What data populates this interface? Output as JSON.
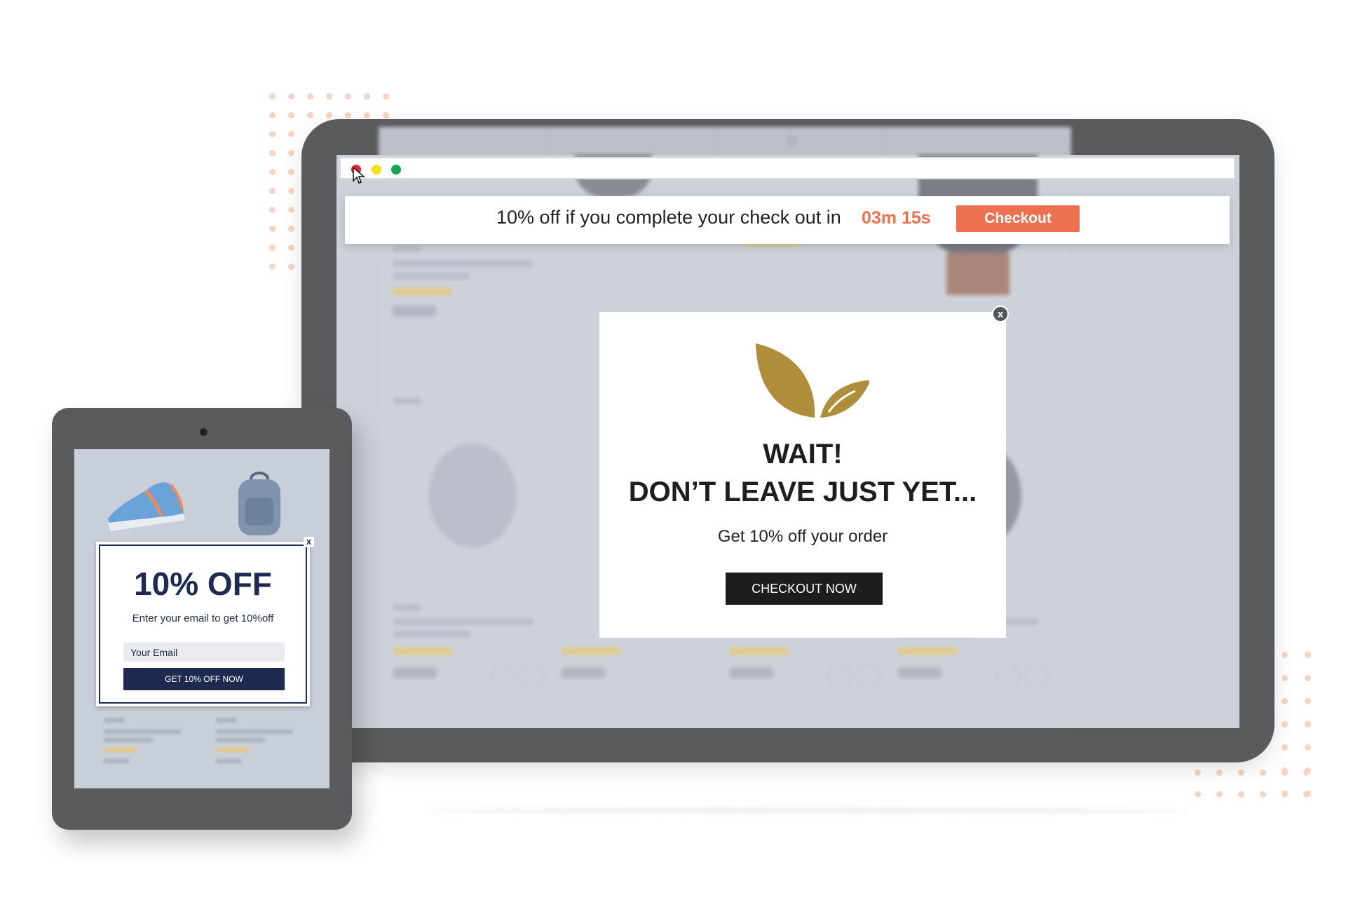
{
  "browser": {
    "window_buttons": [
      "close-dot",
      "minimize-dot",
      "maximize-dot"
    ]
  },
  "top_banner": {
    "message": "10% off if you complete your check out in",
    "timer": "03m 15s",
    "button_label": "Checkout",
    "accent_color": "#ee714f"
  },
  "exit_popup": {
    "close_label": "x",
    "logo_icon": "leaf-logo-icon",
    "headline_line1": "WAIT!",
    "headline_line2": "DON’T LEAVE JUST YET...",
    "subtext": "Get 10% off your order",
    "button_label": "CHECKOUT NOW",
    "logo_color": "#b08d3a"
  },
  "tablet_popup": {
    "close_label": "x",
    "title": "10% OFF",
    "subtext": "Enter your email to get 10%off",
    "email_placeholder": "Your Email",
    "button_label": "GET 10% OFF NOW",
    "brand_color": "#1e2a50"
  },
  "decor": {
    "dot_color": "#f9d3c2"
  }
}
